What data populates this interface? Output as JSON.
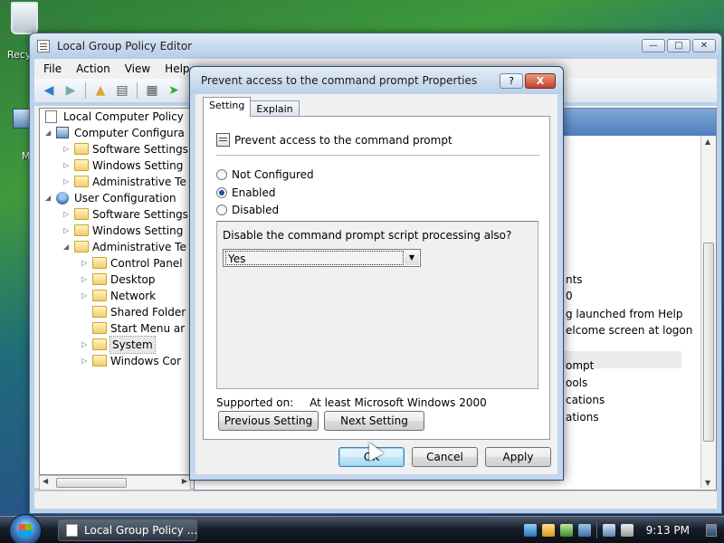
{
  "desktop": {
    "recycle_label": "Recy",
    "computer_label": "M"
  },
  "main_window": {
    "title": "Local Group Policy Editor",
    "menu": [
      "File",
      "Action",
      "View",
      "Help"
    ],
    "tree": [
      {
        "label": "Local Computer Policy",
        "level": 0,
        "icon": "document-icon",
        "expander": ""
      },
      {
        "label": "Computer Configura",
        "level": 1,
        "icon": "computer-icon",
        "expander": "expanded"
      },
      {
        "label": "Software Settings",
        "level": 2,
        "icon": "folder-icon",
        "expander": "collapsed"
      },
      {
        "label": "Windows Setting",
        "level": 2,
        "icon": "folder-icon",
        "expander": "collapsed"
      },
      {
        "label": "Administrative Te",
        "level": 2,
        "icon": "folder-icon",
        "expander": "collapsed"
      },
      {
        "label": "User Configuration",
        "level": 1,
        "icon": "user-icon",
        "expander": "expanded"
      },
      {
        "label": "Software Settings",
        "level": 2,
        "icon": "folder-icon",
        "expander": "collapsed"
      },
      {
        "label": "Windows Setting",
        "level": 2,
        "icon": "folder-icon",
        "expander": "collapsed"
      },
      {
        "label": "Administrative Te",
        "level": 2,
        "icon": "folder-icon",
        "expander": "expanded"
      },
      {
        "label": "Control Panel",
        "level": 3,
        "icon": "folder-icon",
        "expander": "collapsed"
      },
      {
        "label": "Desktop",
        "level": 3,
        "icon": "folder-icon",
        "expander": "collapsed"
      },
      {
        "label": "Network",
        "level": 3,
        "icon": "folder-icon",
        "expander": "collapsed"
      },
      {
        "label": "Shared Folder",
        "level": 3,
        "icon": "folder-icon",
        "expander": ""
      },
      {
        "label": "Start Menu ar",
        "level": 3,
        "icon": "folder-icon",
        "expander": ""
      },
      {
        "label": "System",
        "level": 3,
        "icon": "folder-icon",
        "expander": "collapsed",
        "selected": true
      },
      {
        "label": "Windows Cor",
        "level": 3,
        "icon": "folder-icon",
        "expander": "collapsed"
      }
    ],
    "right_pane_texts": [
      "nts",
      "0",
      "g launched from Help",
      "elcome screen at logon",
      "ompt",
      "ools",
      "cations",
      "ations"
    ]
  },
  "dialog": {
    "title": "Prevent access to the command prompt Properties",
    "help_label": "?",
    "close_label": "X",
    "tabs": [
      "Setting",
      "Explain"
    ],
    "policy_name": "Prevent access to the command prompt",
    "radios": [
      {
        "label": "Not Configured",
        "checked": false
      },
      {
        "label": "Enabled",
        "checked": true
      },
      {
        "label": "Disabled",
        "checked": false
      }
    ],
    "options": {
      "question": "Disable the command prompt script processing also?",
      "selected": "Yes"
    },
    "supported_label": "Supported on:",
    "supported_value": "At least Microsoft Windows 2000",
    "prev_button": "Previous Setting",
    "next_button": "Next Setting",
    "ok_button": "OK",
    "cancel_button": "Cancel",
    "apply_button": "Apply"
  },
  "taskbar": {
    "task_label": "Local Group Policy ...",
    "time": "9:13 PM"
  }
}
